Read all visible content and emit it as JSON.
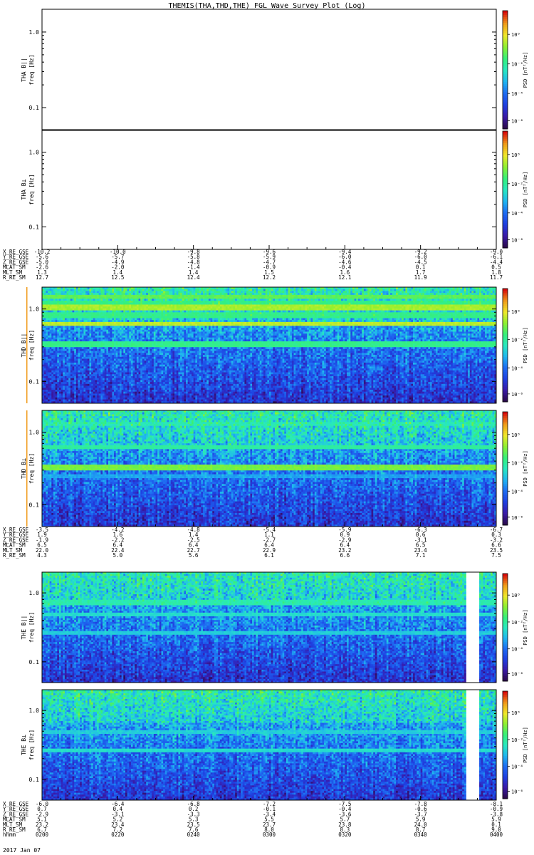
{
  "title": "THEMIS(THA,THD,THE) FGL Wave Survey Plot (Log)",
  "colors": {
    "colormap": [
      "#2a0a4a",
      "#3a1aa8",
      "#1f3fe0",
      "#1e6cf2",
      "#1fb6f0",
      "#28e8c0",
      "#36f078",
      "#8ef030",
      "#f0e82a",
      "#f09a1a",
      "#d80c0c"
    ]
  },
  "chart_data": [
    {
      "type": "heatmap",
      "probe": "tha",
      "panel": "parallel",
      "ylabel": "THA B||",
      "yunit": "freq [Hz]",
      "yscale": "log",
      "ylim": [
        0.05,
        2.0
      ],
      "ytick_labels": [
        "1.0",
        "0.1"
      ],
      "has_data": false,
      "colorbar": {
        "label": "PSD [nT²/Hz]",
        "tick_labels": [
          "10⁰",
          "10⁻²",
          "10⁻⁴",
          "10⁻⁶"
        ]
      }
    },
    {
      "type": "heatmap",
      "probe": "tha",
      "panel": "perpendicular",
      "ylabel": "THA B⊥",
      "yunit": "freq [Hz]",
      "yscale": "log",
      "ylim": [
        0.05,
        2.0
      ],
      "ytick_labels": [
        "1.0",
        "0.1"
      ],
      "has_data": false,
      "colorbar": {
        "label": "PSD [nT²/Hz]",
        "tick_labels": [
          "10⁰",
          "10⁻²",
          "10⁻⁴",
          "10⁻⁶"
        ]
      }
    },
    {
      "type": "heatmap",
      "probe": "thd",
      "panel": "parallel",
      "ylabel": "THD B||",
      "yunit": "freq [Hz]",
      "yscale": "log",
      "ylim": [
        0.05,
        2.0
      ],
      "ytick_labels": [
        "1.0",
        "0.1"
      ],
      "has_data": true,
      "bands": [
        {
          "freq": 1.45,
          "level": 0.62
        },
        {
          "freq": 1.22,
          "level": 0.55
        },
        {
          "freq": 1.05,
          "level": 0.7
        },
        {
          "freq": 0.82,
          "level": 0.55
        },
        {
          "freq": 0.62,
          "level": 0.72
        },
        {
          "freq": 0.33,
          "level": 0.55
        }
      ],
      "vertical_line_time": "0156",
      "colorbar": {
        "label": "PSD [nT²/Hz]",
        "tick_labels": [
          "10⁰",
          "10⁻²",
          "10⁻⁴",
          "10⁻⁶"
        ]
      }
    },
    {
      "type": "heatmap",
      "probe": "thd",
      "panel": "perpendicular",
      "ylabel": "THD B⊥",
      "yunit": "freq [Hz]",
      "yscale": "log",
      "ylim": [
        0.05,
        2.0
      ],
      "ytick_labels": [
        "1.0",
        "0.1"
      ],
      "has_data": true,
      "bands": [
        {
          "freq": 1.3,
          "level": 0.48
        },
        {
          "freq": 0.62,
          "level": 0.52
        },
        {
          "freq": 0.33,
          "level": 0.65
        },
        {
          "freq": 0.25,
          "level": 0.35
        }
      ],
      "vertical_line_time": "0156",
      "colorbar": {
        "label": "PSD [nT²/Hz]",
        "tick_labels": [
          "10⁰",
          "10⁻²",
          "10⁻⁴",
          "10⁻⁶"
        ]
      }
    },
    {
      "type": "heatmap",
      "probe": "the",
      "panel": "parallel",
      "ylabel": "THE B||",
      "yunit": "freq [Hz]",
      "yscale": "log",
      "ylim": [
        0.05,
        2.0
      ],
      "ytick_labels": [
        "1.0",
        "0.1"
      ],
      "has_data": true,
      "bands": [
        {
          "freq": 0.72,
          "level": 0.5
        },
        {
          "freq": 0.48,
          "level": 0.45
        },
        {
          "freq": 0.26,
          "level": 0.42
        }
      ],
      "data_gap_time": [
        "0352",
        "0355"
      ],
      "colorbar": {
        "label": "PSD [nT²/Hz]",
        "tick_labels": [
          "10⁰",
          "10⁻²",
          "10⁻⁴",
          "10⁻⁶"
        ]
      }
    },
    {
      "type": "heatmap",
      "probe": "the",
      "panel": "perpendicular",
      "ylabel": "THE B⊥",
      "yunit": "freq [Hz]",
      "yscale": "log",
      "ylim": [
        0.05,
        2.0
      ],
      "ytick_labels": [
        "1.0",
        "0.1"
      ],
      "has_data": true,
      "bands": [
        {
          "freq": 0.48,
          "level": 0.42
        },
        {
          "freq": 0.26,
          "level": 0.45
        }
      ],
      "data_gap_time": [
        "0352",
        "0355"
      ],
      "colorbar": {
        "label": "PSD [nT²/Hz]",
        "tick_labels": [
          "10⁰",
          "10⁻²",
          "10⁻⁴",
          "10⁻⁶"
        ]
      }
    }
  ],
  "ephemeris": [
    {
      "probe": "tha",
      "rows": [
        {
          "label": "X_RE_GSE",
          "values": [
            "-10.2",
            "-10.0",
            "-9.8",
            "-9.6",
            "-9.4",
            "-9.2",
            "-9.0"
          ]
        },
        {
          "label": "Y_RE_GSE",
          "values": [
            "-5.6",
            "-5.7",
            "-5.8",
            "-5.9",
            "-6.0",
            "-6.0",
            "-6.1"
          ]
        },
        {
          "label": "Z_RE_GSE",
          "values": [
            "-5.0",
            "-4.9",
            "-4.8",
            "-4.7",
            "-4.6",
            "-4.5",
            "-4.4"
          ]
        },
        {
          "label": "MLAT_SM",
          "values": [
            "-2.6",
            "-2.0",
            "-1.4",
            "-0.9",
            "-0.4",
            "0.1",
            "0.5"
          ]
        },
        {
          "label": "MLT_SM",
          "values": [
            "1.3",
            "1.4",
            "1.4",
            "1.5",
            "1.6",
            "1.7",
            "1.8"
          ]
        },
        {
          "label": "R_RE_SM",
          "values": [
            "12.7",
            "12.5",
            "12.4",
            "12.2",
            "12.1",
            "11.9",
            "11.7"
          ]
        }
      ]
    },
    {
      "probe": "thd",
      "rows": [
        {
          "label": "X_RE_GSE",
          "values": [
            "-3.5",
            "-4.2",
            "-4.8",
            "-5.4",
            "-5.9",
            "-6.3",
            "-6.7"
          ]
        },
        {
          "label": "Y_RE_GSE",
          "values": [
            "1.9",
            "1.6",
            "1.4",
            "1.1",
            "0.9",
            "0.6",
            "0.3"
          ]
        },
        {
          "label": "Z_RE_GSE",
          "values": [
            "-1.9",
            "-2.2",
            "-2.5",
            "-2.7",
            "-2.9",
            "-3.1",
            "-3.2"
          ]
        },
        {
          "label": "MLAT_SM",
          "values": [
            "6.5",
            "6.4",
            "6.4",
            "6.4",
            "6.4",
            "6.5",
            "6.6"
          ]
        },
        {
          "label": "MLT_SM",
          "values": [
            "22.0",
            "22.4",
            "22.7",
            "22.9",
            "23.2",
            "23.4",
            "23.5"
          ]
        },
        {
          "label": "R_RE_SM",
          "values": [
            "4.3",
            "5.0",
            "5.6",
            "6.1",
            "6.6",
            "7.1",
            "7.5"
          ]
        }
      ]
    },
    {
      "probe": "the",
      "rows": [
        {
          "label": "X_RE_GSE",
          "values": [
            "-6.0",
            "-6.4",
            "-6.8",
            "-7.2",
            "-7.5",
            "-7.8",
            "-8.1"
          ]
        },
        {
          "label": "Y_RE_GSE",
          "values": [
            "0.7",
            "0.4",
            "0.2",
            "-0.1",
            "-0.4",
            "-0.6",
            "-0.9"
          ]
        },
        {
          "label": "Z_RE_GSE",
          "values": [
            "-2.9",
            "-3.1",
            "-3.3",
            "-3.4",
            "-3.6",
            "-3.7",
            "-3.8"
          ]
        },
        {
          "label": "MLAT_SM",
          "values": [
            "5.1",
            "5.2",
            "5.3",
            "5.5",
            "5.7",
            "5.9",
            "5.9"
          ]
        },
        {
          "label": "MLT_SM",
          "values": [
            "23.2",
            "23.4",
            "23.5",
            "23.7",
            "23.8",
            "24.0",
            "0.1"
          ]
        },
        {
          "label": "R_RE_SM",
          "values": [
            "6.7",
            "7.2",
            "7.6",
            "8.0",
            "8.3",
            "8.7",
            "9.0"
          ]
        },
        {
          "label": "hhmm",
          "values": [
            "0200",
            "0220",
            "0240",
            "0300",
            "0320",
            "0340",
            "0400"
          ]
        }
      ]
    }
  ],
  "date_label": "2017 Jan 07"
}
